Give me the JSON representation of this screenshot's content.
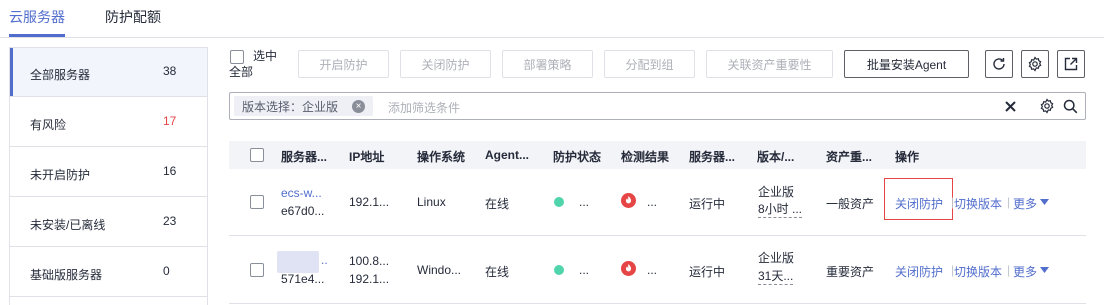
{
  "tabs": [
    {
      "label": "云服务器",
      "active": true
    },
    {
      "label": "防护配额",
      "active": false
    }
  ],
  "sidebar": {
    "items": [
      {
        "label": "全部服务器",
        "count": "38"
      },
      {
        "label": "有风险",
        "count": "17"
      },
      {
        "label": "未开启防护",
        "count": "16"
      },
      {
        "label": "未安装/已离线",
        "count": "23"
      },
      {
        "label": "基础版服务器",
        "count": "0"
      }
    ]
  },
  "toolbar": {
    "select_all": "选中全部",
    "select_all_line1": "选中",
    "select_all_line2": "全部",
    "enable_protection": "开启防护",
    "disable_protection": "关闭防护",
    "deploy_policy": "部署策略",
    "assign_group": "分配到组",
    "asset_importance": "关联资产重要性",
    "batch_install": "批量安装Agent"
  },
  "filter": {
    "tag": "版本选择：企业版",
    "placeholder": "添加筛选条件"
  },
  "table": {
    "headers": [
      "服务器...",
      "IP地址",
      "操作系统",
      "Agent...",
      "防护状态",
      "检测结果",
      "服务器...",
      "版本/...",
      "资产重...",
      "操作"
    ],
    "rows": [
      {
        "name": "ecs-w...",
        "id": "e67d0...",
        "ip1": "192.1...",
        "ip2": "",
        "os": "Linux",
        "agent": "在线",
        "protection": "...",
        "detection": "...",
        "server_status": "运行中",
        "version": "企业版",
        "version_sub": "8小时 ...",
        "asset": "一般资产",
        "action1": "关闭防护",
        "action2": "切换版本",
        "action3": "更多"
      },
      {
        "name": "..",
        "id": "571e4...",
        "ip1": "100.8...",
        "ip2": "192.1...",
        "os": "Windo...",
        "agent": "在线",
        "protection": "...",
        "detection": "...",
        "server_status": "运行中",
        "version": "企业版",
        "version_sub": "31天...",
        "asset": "重要资产",
        "action1": "关闭防护",
        "action2": "切换版本",
        "action3": "更多"
      }
    ]
  },
  "colors": {
    "accent": "#526ecc",
    "risk": "#e54545",
    "online": "#50d4ab"
  },
  "icons": [
    "refresh-icon",
    "settings-icon",
    "export-icon",
    "clear-icon",
    "filter-settings-icon",
    "search-icon",
    "flame-icon",
    "chevron-down-icon"
  ]
}
